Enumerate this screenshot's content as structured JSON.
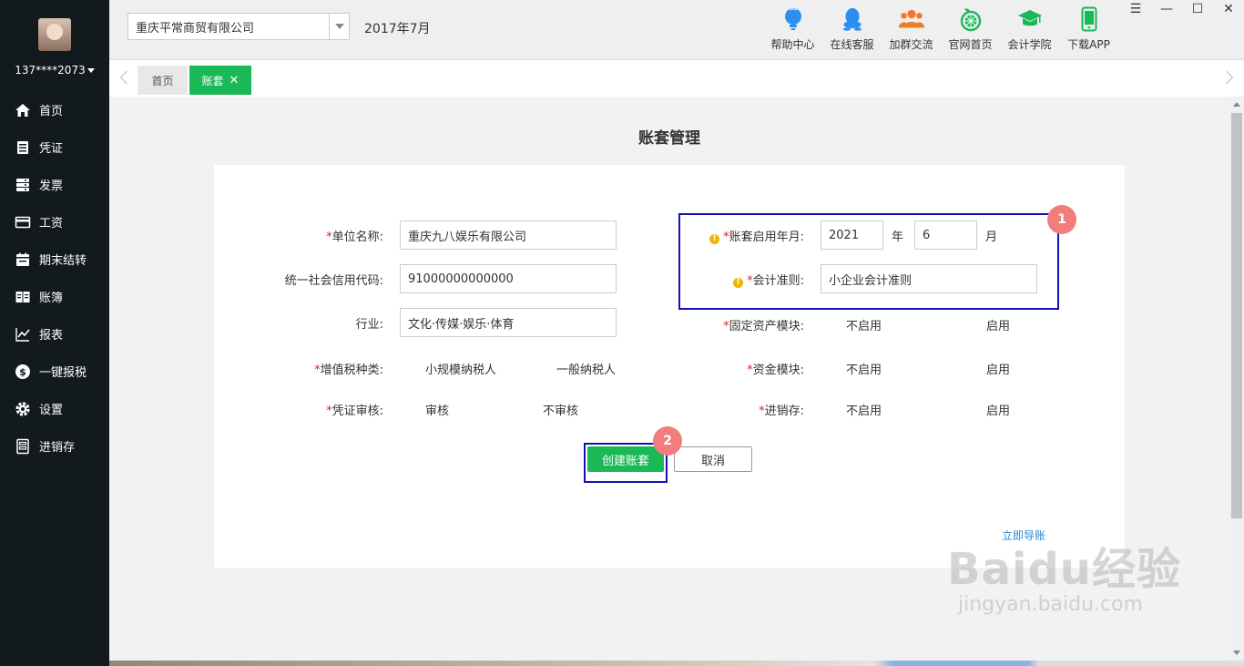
{
  "sidebar": {
    "username": "137****2073",
    "items": [
      {
        "label": "首页",
        "icon": "home-icon"
      },
      {
        "label": "凭证",
        "icon": "document-icon"
      },
      {
        "label": "发票",
        "icon": "invoice-icon"
      },
      {
        "label": "工资",
        "icon": "card-icon"
      },
      {
        "label": "期末结转",
        "icon": "calendar-icon"
      },
      {
        "label": "账簿",
        "icon": "book-icon"
      },
      {
        "label": "报表",
        "icon": "chart-icon"
      },
      {
        "label": "一键报税",
        "icon": "dollar-icon"
      },
      {
        "label": "设置",
        "icon": "gear-icon"
      },
      {
        "label": "进销存",
        "icon": "inventory-icon"
      }
    ]
  },
  "header": {
    "company": "重庆平常商贸有限公司",
    "period": "2017年7月",
    "tools": [
      {
        "label": "帮助中心",
        "icon": "help-bulb-icon",
        "color": "#2b8ff0"
      },
      {
        "label": "在线客服",
        "icon": "qq-icon",
        "color": "#2b8ff0"
      },
      {
        "label": "加群交流",
        "icon": "group-icon",
        "color": "#f07a28"
      },
      {
        "label": "官网首页",
        "icon": "orange-logo-icon",
        "color": "#19b955"
      },
      {
        "label": "会计学院",
        "icon": "graduation-cap-icon",
        "color": "#19b955"
      },
      {
        "label": "下载APP",
        "icon": "phone-icon",
        "color": "#19b955"
      }
    ],
    "window_controls": {
      "menu": "☰",
      "minimize": "—",
      "maximize": "☐",
      "close": "✕"
    }
  },
  "tabs": {
    "home": "首页",
    "active": "账套",
    "close": "✕"
  },
  "main": {
    "title": "账套管理",
    "form": {
      "unit_name": {
        "label": "单位名称:",
        "value": "重庆九八娱乐有限公司"
      },
      "credit_code": {
        "label": "统一社会信用代码:",
        "value": "91000000000000"
      },
      "industry": {
        "label": "行业:",
        "value": "文化·传媒·娱乐·体育"
      },
      "vat_type": {
        "label": "增值税种类:",
        "options": [
          "小规模纳税人",
          "一般纳税人"
        ]
      },
      "voucher_review": {
        "label": "凭证审核:",
        "options": [
          "审核",
          "不审核"
        ]
      },
      "start_period": {
        "label": "账套启用年月:",
        "year": "2021",
        "year_unit": "年",
        "month": "6",
        "month_unit": "月"
      },
      "accounting_standard": {
        "label": "会计准则:",
        "value": "小企业会计准则"
      },
      "fixed_assets": {
        "label": "固定资产模块:",
        "options": [
          "不启用",
          "启用"
        ]
      },
      "funds": {
        "label": "资金模块:",
        "options": [
          "不启用",
          "启用"
        ]
      },
      "inventory": {
        "label": "进销存:",
        "options": [
          "不启用",
          "启用"
        ]
      },
      "required_mark": "*",
      "warn_mark": "!"
    },
    "buttons": {
      "create": "创建账套",
      "cancel": "取消"
    },
    "import_link": "立即导账",
    "annotations": [
      "1",
      "2"
    ]
  },
  "watermark": {
    "main": "Baidu经验",
    "sub": "jingyan.baidu.com"
  },
  "colors": {
    "accent": "#19b955",
    "highlight": "#1410b4",
    "badge": "#f27d7d",
    "link": "#2a8ad4"
  }
}
